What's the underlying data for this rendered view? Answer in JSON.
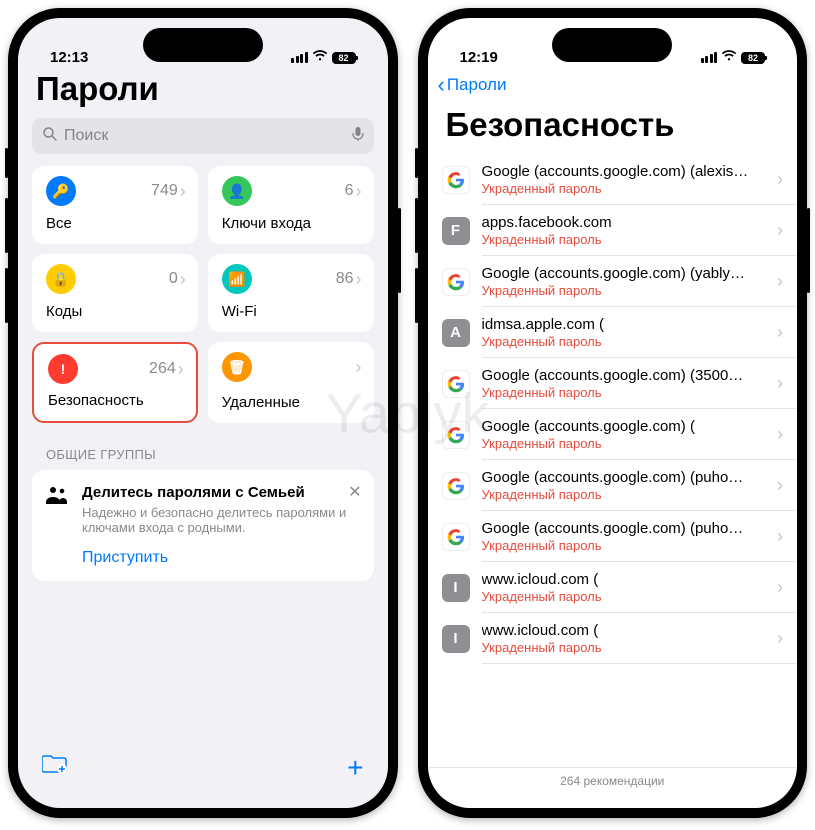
{
  "watermark": "Yablyk",
  "left": {
    "status": {
      "time": "12:13",
      "battery": "82"
    },
    "title": "Пароли",
    "search": {
      "placeholder": "Поиск"
    },
    "tiles": [
      {
        "label": "Все",
        "count": "749",
        "color": "#007aff",
        "glyph": "🔑",
        "highlighted": false
      },
      {
        "label": "Ключи входа",
        "count": "6",
        "color": "#34c759",
        "glyph": "👤",
        "highlighted": false
      },
      {
        "label": "Коды",
        "count": "0",
        "color": "#ffcc00",
        "glyph": "🔒",
        "highlighted": false
      },
      {
        "label": "Wi-Fi",
        "count": "86",
        "color": "#00c7be",
        "glyph": "📶",
        "highlighted": false
      },
      {
        "label": "Безопасность",
        "count": "264",
        "color": "#ff3b30",
        "glyph": "!",
        "highlighted": true
      },
      {
        "label": "Удаленные",
        "count": "",
        "color": "#ff9500",
        "glyph": "🗑",
        "highlighted": false
      }
    ],
    "section_header": "ОБЩИЕ ГРУППЫ",
    "share": {
      "title": "Делитесь паролями с Семьей",
      "body": "Надежно и безопасно делитесь паролями и ключами входа с родными.",
      "action": "Приступить"
    }
  },
  "right": {
    "status": {
      "time": "12:19",
      "battery": "82"
    },
    "back_label": "Пароли",
    "title": "Безопасность",
    "items": [
      {
        "icon": "google",
        "letter": "",
        "title": "Google (accounts.google.com) (alexis…",
        "sub": "Украденный пароль"
      },
      {
        "icon": "gray",
        "letter": "F",
        "title": "apps.facebook.com",
        "sub": "Украденный пароль"
      },
      {
        "icon": "google",
        "letter": "",
        "title": "Google (accounts.google.com) (yably…",
        "sub": "Украденный пароль"
      },
      {
        "icon": "gray",
        "letter": "A",
        "title": "idmsa.apple.com (",
        "sub": "Украденный пароль"
      },
      {
        "icon": "google",
        "letter": "",
        "title": "Google (accounts.google.com) (3500…",
        "sub": "Украденный пароль"
      },
      {
        "icon": "google",
        "letter": "",
        "title": "Google (accounts.google.com) (",
        "sub": "Украденный пароль"
      },
      {
        "icon": "google",
        "letter": "",
        "title": "Google (accounts.google.com) (puho…",
        "sub": "Украденный пароль"
      },
      {
        "icon": "google",
        "letter": "",
        "title": "Google (accounts.google.com) (puho…",
        "sub": "Украденный пароль"
      },
      {
        "icon": "gray",
        "letter": "I",
        "title": "www.icloud.com (",
        "sub": "Украденный пароль"
      },
      {
        "icon": "gray",
        "letter": "I",
        "title": "www.icloud.com (",
        "sub": "Украденный пароль"
      }
    ],
    "footer": "264 рекомендации"
  }
}
